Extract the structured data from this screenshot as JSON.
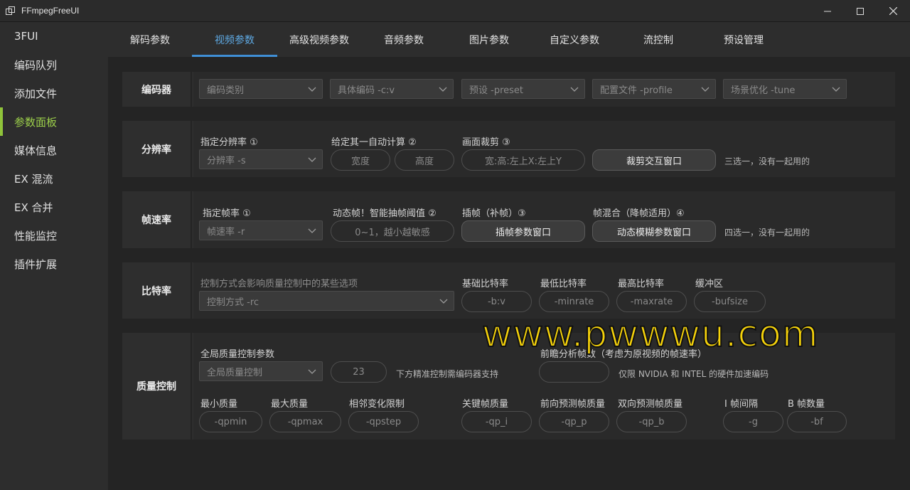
{
  "window": {
    "title": "FFmpegFreeUI",
    "minimize_icon": "minimize-icon",
    "maximize_icon": "maximize-icon",
    "close_icon": "close-icon"
  },
  "sidebar": {
    "items": [
      {
        "label": "3FUI"
      },
      {
        "label": "编码队列"
      },
      {
        "label": "添加文件"
      },
      {
        "label": "参数面板",
        "active": true
      },
      {
        "label": "媒体信息"
      },
      {
        "label": "EX 混流"
      },
      {
        "label": "EX 合并"
      },
      {
        "label": "性能监控"
      },
      {
        "label": "插件扩展"
      }
    ],
    "accent": "#8fc33a"
  },
  "tabs": [
    {
      "label": "解码参数"
    },
    {
      "label": "视频参数",
      "active": true
    },
    {
      "label": "高级视频参数"
    },
    {
      "label": "音频参数"
    },
    {
      "label": "图片参数"
    },
    {
      "label": "自定义参数"
    },
    {
      "label": "流控制"
    },
    {
      "label": "预设管理"
    }
  ],
  "encoder": {
    "label": "编码器",
    "category": "编码类别",
    "codec": "具体编码 -c:v",
    "preset": "预设 -preset",
    "profile": "配置文件 -profile",
    "tune": "场景优化 -tune"
  },
  "resolution": {
    "label": "分辨率",
    "opt1_label": "指定分辨率 ①",
    "opt1_dropdown": "分辨率 -s",
    "opt2_label": "给定其一自动计算 ②",
    "width": "宽度",
    "height": "高度",
    "opt3_label": "画面裁剪 ③",
    "crop_placeholder": "宽:高:左上X:左上Y",
    "crop_button": "裁剪交互窗口",
    "note": "三选一，没有一起用的"
  },
  "framerate": {
    "label": "帧速率",
    "opt1_label": "指定帧率 ①",
    "opt1_dropdown": "帧速率 -r",
    "opt2_label": "动态帧！智能抽帧阈值 ②",
    "threshold_placeholder": "0~1，越小越敏感",
    "opt3_label": "插帧（补帧）③",
    "interp_button": "插帧参数窗口",
    "opt4_label": "帧混合（降帧适用）④",
    "blur_button": "动态模糊参数窗口",
    "note": "四选一，没有一起用的"
  },
  "bitrate": {
    "label": "比特率",
    "hint": "控制方式会影响质量控制中的某些选项",
    "mode_dropdown": "控制方式 -rc",
    "base_label": "基础比特率",
    "base_placeholder": "-b:v",
    "min_label": "最低比特率",
    "min_placeholder": "-minrate",
    "max_label": "最高比特率",
    "max_placeholder": "-maxrate",
    "buf_label": "缓冲区",
    "buf_placeholder": "-bufsize"
  },
  "quality": {
    "label": "质量控制",
    "global_label": "全局质量控制参数",
    "global_dropdown": "全局质量控制",
    "global_value": "23",
    "global_note": "下方精准控制需编码器支持",
    "lookahead_label": "前瞻分析帧数（考虑为原视频的帧速率）",
    "lookahead_note": "仅限 NVIDIA 和 INTEL 的硬件加速编码",
    "qpmin_label": "最小质量",
    "qpmin": "-qpmin",
    "qpmax_label": "最大质量",
    "qpmax": "-qpmax",
    "qpstep_label": "相邻变化限制",
    "qpstep": "-qpstep",
    "qpi_label": "关键帧质量",
    "qpi": "-qp_i",
    "qpp_label": "前向预测帧质量",
    "qpp": "-qp_p",
    "qpb_label": "双向预测帧质量",
    "qpb": "-qp_b",
    "gop_label": "I 帧间隔",
    "gop": "-g",
    "bf_label": "B 帧数量",
    "bf": "-bf"
  },
  "watermark": "www.pwwwu.com"
}
